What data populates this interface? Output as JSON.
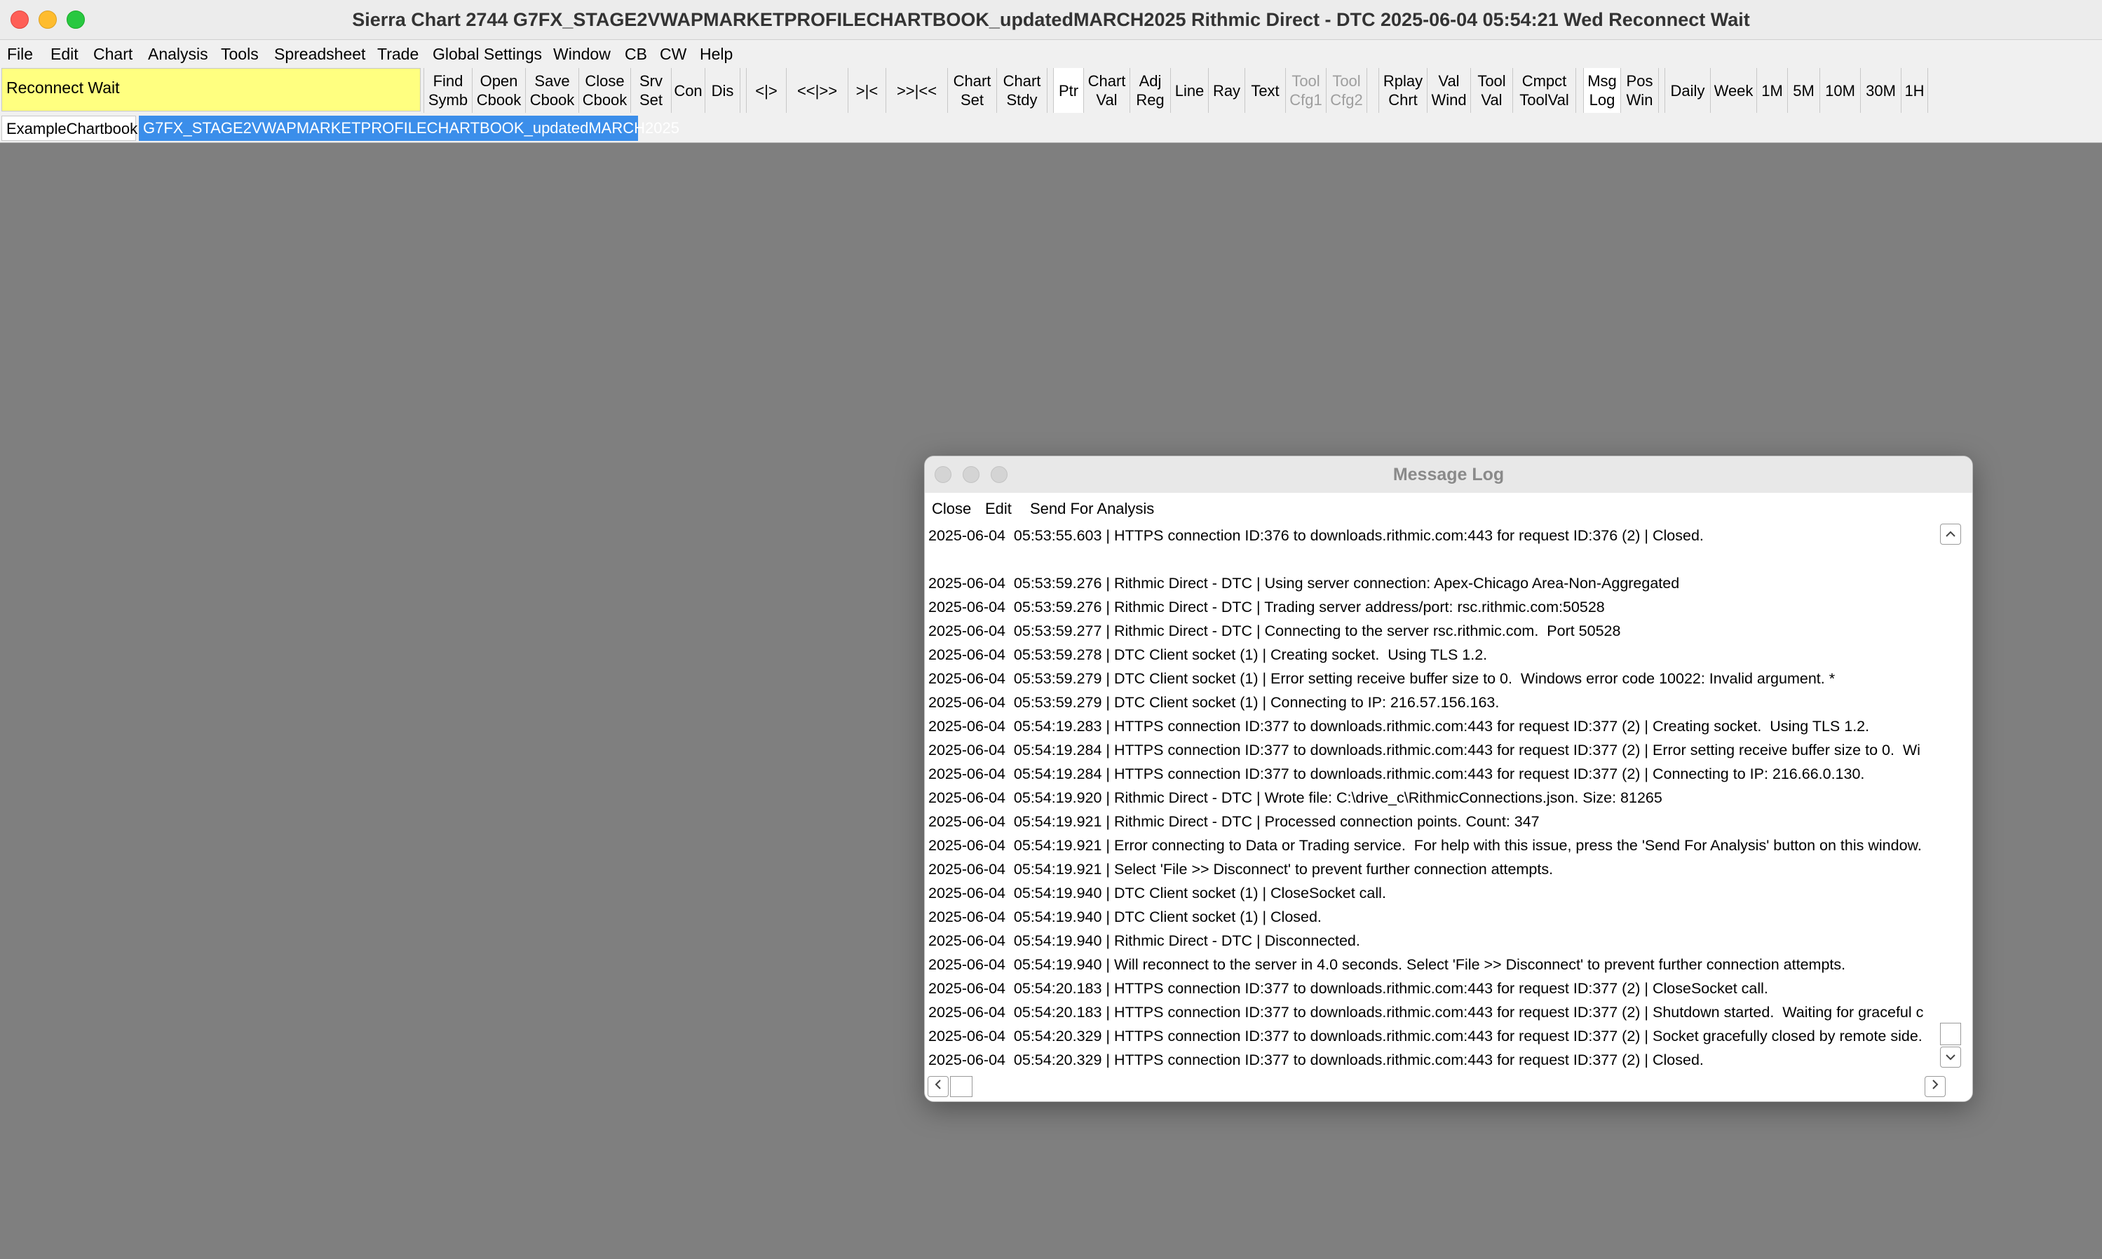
{
  "window": {
    "title": "Sierra Chart 2744 G7FX_STAGE2VWAPMARKETPROFILECHARTBOOK_updatedMARCH2025 Rithmic Direct - DTC 2025-06-04  05:54:21 Wed Reconnect Wait"
  },
  "menu": [
    "File",
    "Edit",
    "Chart",
    "Analysis",
    "Tools",
    "Spreadsheet",
    "Trade",
    "Global Settings",
    "Window",
    "CB",
    "CW",
    "Help"
  ],
  "toolbar": {
    "status": "Reconnect Wait",
    "buttons": [
      {
        "line1": "Find",
        "line2": "Symb"
      },
      {
        "line1": "Open",
        "line2": "Cbook"
      },
      {
        "line1": "Save",
        "line2": "Cbook"
      },
      {
        "line1": "Close",
        "line2": "Cbook"
      },
      {
        "line1": "Srv",
        "line2": "Set"
      },
      {
        "line1": "Con",
        "line2": ""
      },
      {
        "line1": "Dis",
        "line2": ""
      },
      {
        "line1": "<|>",
        "line2": ""
      },
      {
        "line1": "<<|>>",
        "line2": ""
      },
      {
        "line1": ">|<",
        "line2": ""
      },
      {
        "line1": ">>|<<",
        "line2": ""
      },
      {
        "line1": "Chart",
        "line2": "Set"
      },
      {
        "line1": "Chart",
        "line2": "Stdy"
      },
      {
        "line1": "Ptr",
        "line2": ""
      },
      {
        "line1": "Chart",
        "line2": "Val"
      },
      {
        "line1": "Adj",
        "line2": "Reg"
      },
      {
        "line1": "Line",
        "line2": ""
      },
      {
        "line1": "Ray",
        "line2": ""
      },
      {
        "line1": "Text",
        "line2": ""
      },
      {
        "line1": "Tool",
        "line2": "Cfg1"
      },
      {
        "line1": "Tool",
        "line2": "Cfg2"
      },
      {
        "line1": "Rplay",
        "line2": "Chrt"
      },
      {
        "line1": "Val",
        "line2": "Wind"
      },
      {
        "line1": "Tool",
        "line2": "Val"
      },
      {
        "line1": "Cmpct",
        "line2": "ToolVal"
      },
      {
        "line1": "Msg",
        "line2": "Log"
      },
      {
        "line1": "Pos",
        "line2": "Win"
      },
      {
        "line1": "Daily",
        "line2": ""
      },
      {
        "line1": "Week",
        "line2": ""
      },
      {
        "line1": "1M",
        "line2": ""
      },
      {
        "line1": "5M",
        "line2": ""
      },
      {
        "line1": "10M",
        "line2": ""
      },
      {
        "line1": "30M",
        "line2": ""
      },
      {
        "line1": "1H",
        "line2": ""
      }
    ]
  },
  "tabs": [
    "ExampleChartbook",
    "G7FX_STAGE2VWAPMARKETPROFILECHARTBOOK_updatedMARCH2025"
  ],
  "message_log": {
    "title": "Message Log",
    "menu": [
      "Close",
      "Edit",
      "Send For Analysis"
    ],
    "lines": [
      "2025-06-04  05:53:55.603 | HTTPS connection ID:376 to downloads.rithmic.com:443 for request ID:376 (2) | Closed.",
      "",
      "2025-06-04  05:53:59.276 | Rithmic Direct - DTC | Using server connection: Apex-Chicago Area-Non-Aggregated",
      "2025-06-04  05:53:59.276 | Rithmic Direct - DTC | Trading server address/port: rsc.rithmic.com:50528",
      "2025-06-04  05:53:59.277 | Rithmic Direct - DTC | Connecting to the server rsc.rithmic.com.  Port 50528",
      "2025-06-04  05:53:59.278 | DTC Client socket (1) | Creating socket.  Using TLS 1.2.",
      "2025-06-04  05:53:59.279 | DTC Client socket (1) | Error setting receive buffer size to 0.  Windows error code 10022: Invalid argument. *",
      "2025-06-04  05:53:59.279 | DTC Client socket (1) | Connecting to IP: 216.57.156.163.",
      "2025-06-04  05:54:19.283 | HTTPS connection ID:377 to downloads.rithmic.com:443 for request ID:377 (2) | Creating socket.  Using TLS 1.2.",
      "2025-06-04  05:54:19.284 | HTTPS connection ID:377 to downloads.rithmic.com:443 for request ID:377 (2) | Error setting receive buffer size to 0.  Wi",
      "2025-06-04  05:54:19.284 | HTTPS connection ID:377 to downloads.rithmic.com:443 for request ID:377 (2) | Connecting to IP: 216.66.0.130.",
      "2025-06-04  05:54:19.920 | Rithmic Direct - DTC | Wrote file: C:\\drive_c\\RithmicConnections.json. Size: 81265",
      "2025-06-04  05:54:19.921 | Rithmic Direct - DTC | Processed connection points. Count: 347",
      "2025-06-04  05:54:19.921 | Error connecting to Data or Trading service.  For help with this issue, press the 'Send For Analysis' button on this window.",
      "2025-06-04  05:54:19.921 | Select 'File >> Disconnect' to prevent further connection attempts.",
      "2025-06-04  05:54:19.940 | DTC Client socket (1) | CloseSocket call.",
      "2025-06-04  05:54:19.940 | DTC Client socket (1) | Closed.",
      "2025-06-04  05:54:19.940 | Rithmic Direct - DTC | Disconnected.",
      "2025-06-04  05:54:19.940 | Will reconnect to the server in 4.0 seconds. Select 'File >> Disconnect' to prevent further connection attempts.",
      "2025-06-04  05:54:20.183 | HTTPS connection ID:377 to downloads.rithmic.com:443 for request ID:377 (2) | CloseSocket call.",
      "2025-06-04  05:54:20.183 | HTTPS connection ID:377 to downloads.rithmic.com:443 for request ID:377 (2) | Shutdown started.  Waiting for graceful c",
      "2025-06-04  05:54:20.329 | HTTPS connection ID:377 to downloads.rithmic.com:443 for request ID:377 (2) | Socket gracefully closed by remote side.",
      "2025-06-04  05:54:20.329 | HTTPS connection ID:377 to downloads.rithmic.com:443 for request ID:377 (2) | Closed."
    ]
  },
  "colors": {
    "status_bg": "#ffff80",
    "tab_active": "#3b8eea",
    "desktop_bg": "#7f7f7f"
  }
}
